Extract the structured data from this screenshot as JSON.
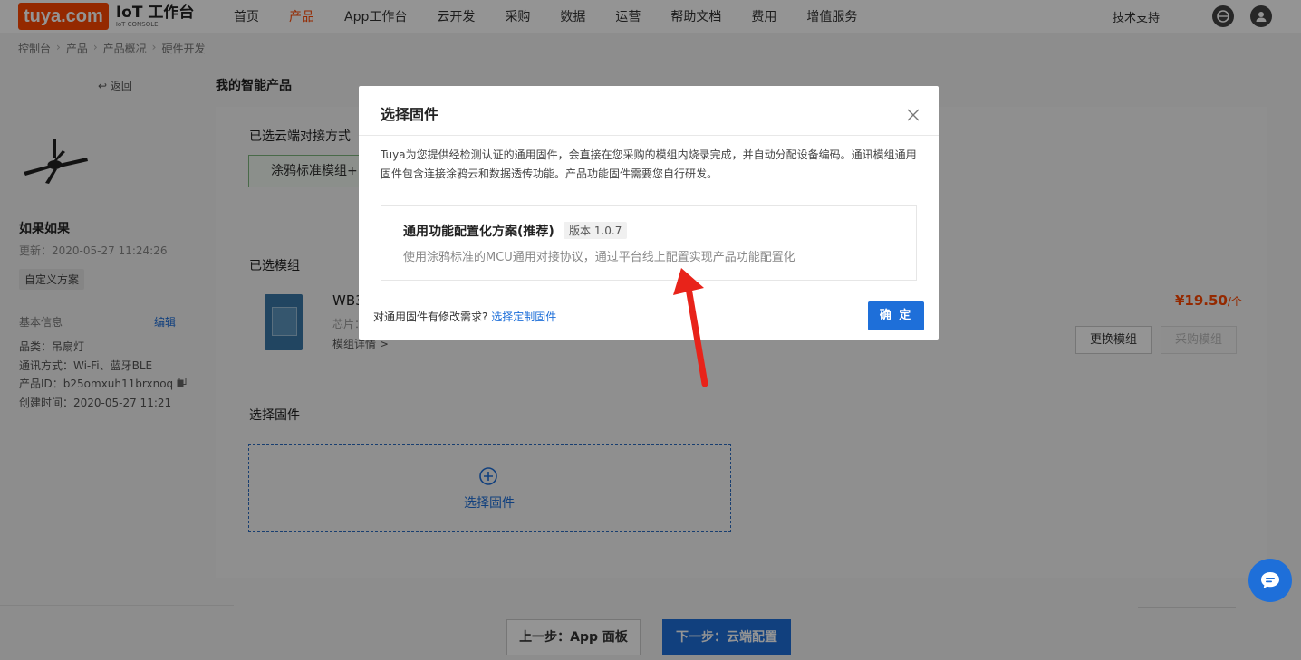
{
  "logo": {
    "brand": "tuya.com",
    "title": "IoT 工作台",
    "subtitle": "IoT CONSOLE"
  },
  "nav": {
    "items": [
      {
        "label": "首页"
      },
      {
        "label": "产品"
      },
      {
        "label": "App工作台"
      },
      {
        "label": "云开发"
      },
      {
        "label": "采购"
      },
      {
        "label": "数据"
      },
      {
        "label": "运营"
      },
      {
        "label": "帮助文档"
      },
      {
        "label": "费用"
      },
      {
        "label": "增值服务"
      }
    ],
    "support": "技术支持"
  },
  "breadcrumb": [
    "控制台",
    "产品",
    "产品概况",
    "硬件开发"
  ],
  "sidebar": {
    "back": "返回",
    "product_name": "如果如果",
    "updated": "更新：2020-05-27 11:24:26",
    "scheme_tag": "自定义方案",
    "basic_info_label": "基本信息",
    "edit_label": "编辑",
    "info": {
      "category": "品类：吊扇灯",
      "comm": "通讯方式：Wi-Fi、蓝牙BLE",
      "product_id": "产品ID：b25omxuh11brxnoq",
      "created": "创建时间：2020-05-27 11:21"
    }
  },
  "page_title": "我的智能产品",
  "main": {
    "cloud_title": "已选云端对接方式",
    "cloud_btn": "涂鸦标准模组+M",
    "module_title": "已选模组",
    "module_name": "WB3",
    "module_chip": "芯片：",
    "module_detail": "模组详情 >",
    "price": "¥19.50",
    "price_unit": "/个",
    "change_btn": "更换模组",
    "buy_btn": "采购模组",
    "firmware_title": "选择固件",
    "firmware_select": "选择固件"
  },
  "footer": {
    "prev": "上一步：App 面板",
    "next": "下一步：云端配置"
  },
  "modal": {
    "title": "选择固件",
    "description": "Tuya为您提供经检测认证的通用固件，会直接在您采购的模组内烧录完成，并自动分配设备编码。通讯模组通用固件包含连接涂鸦云和数据透传功能。产品功能固件需要您自行研发。",
    "option": {
      "title": "通用功能配置化方案(推荐)",
      "version": "版本 1.0.7",
      "description": "使用涂鸦标准的MCU通用对接协议，通过平台线上配置实现产品功能配置化"
    },
    "footer_question": "对通用固件有修改需求?",
    "footer_link": "选择定制固件",
    "confirm": "确 定"
  },
  "colors": {
    "brand": "#ff4800",
    "primary": "#1e6fd9",
    "arrow": "#e8231a"
  },
  "icons": [
    "close-icon",
    "chat-icon",
    "plus-circle-icon",
    "globe-icon",
    "user-icon",
    "copy-icon",
    "back-arrow-icon"
  ]
}
